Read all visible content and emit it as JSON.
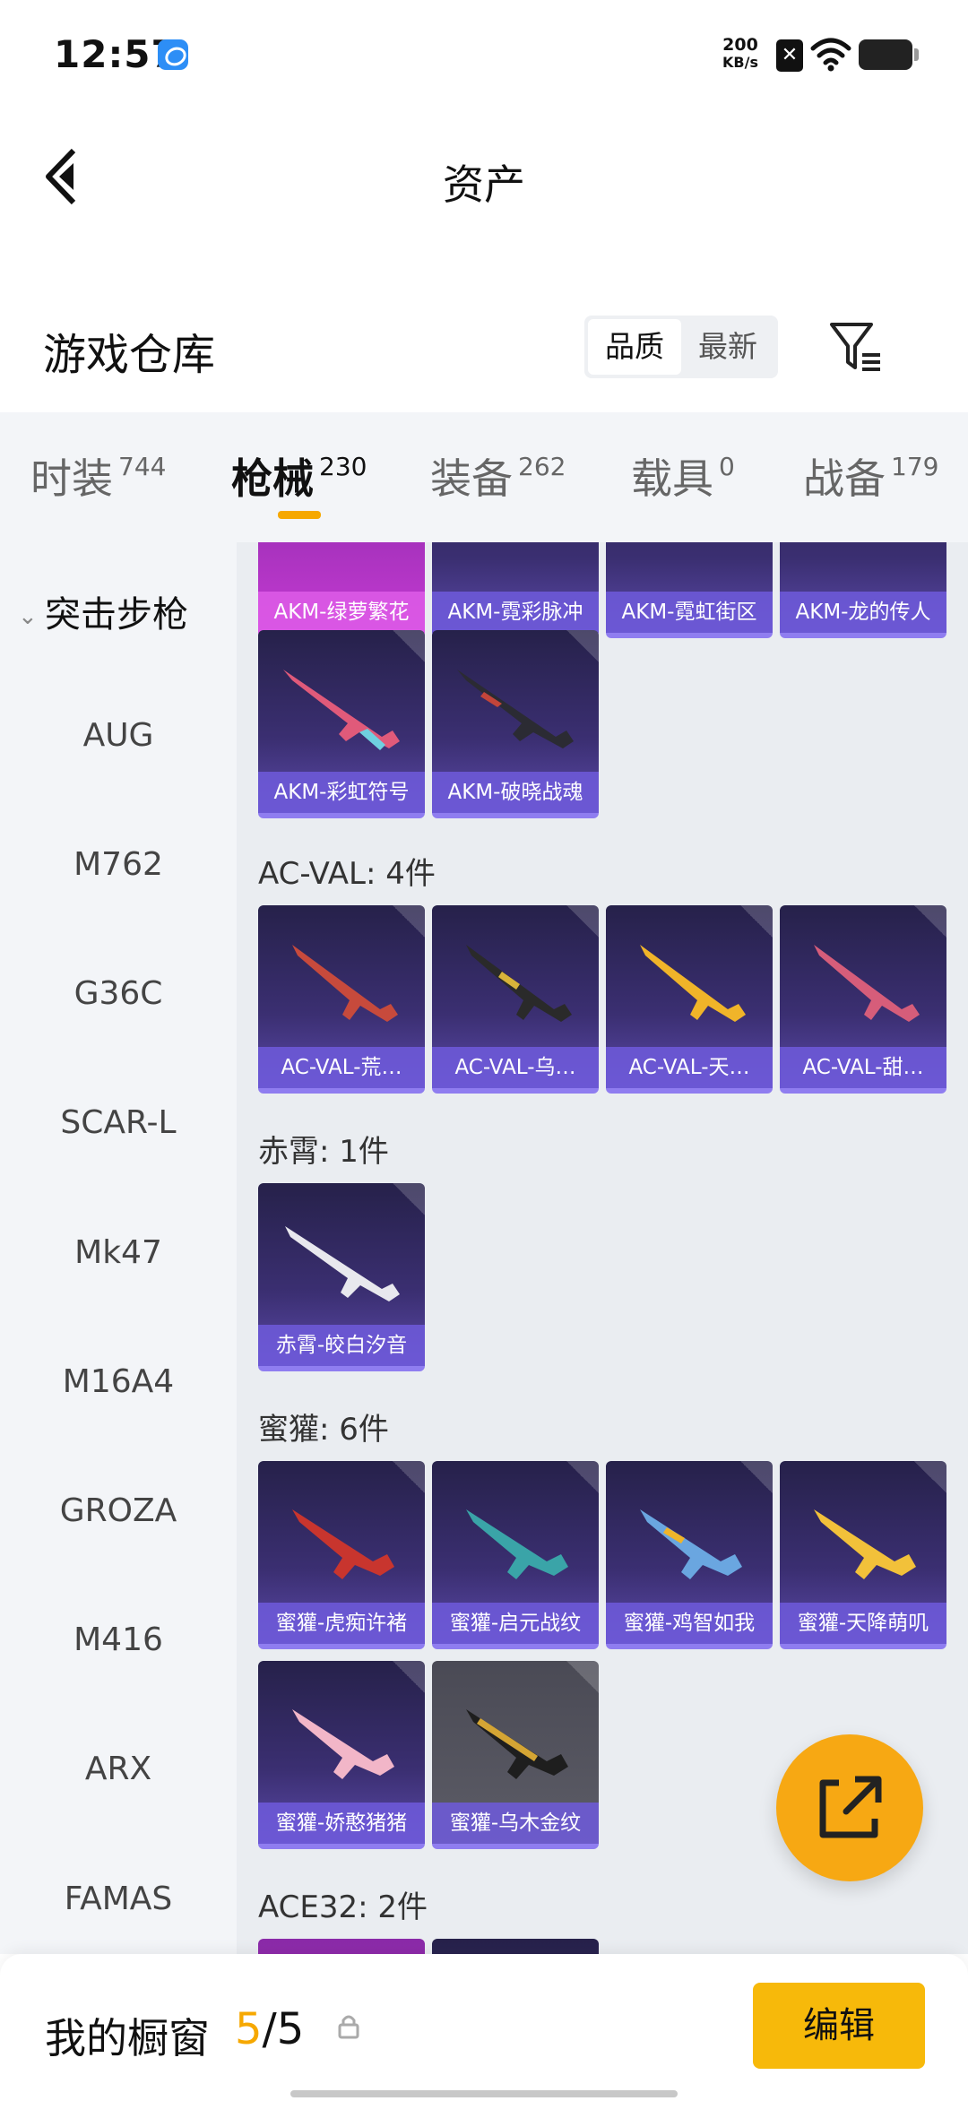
{
  "status_bar": {
    "time": "12:57",
    "net_speed_value": "200",
    "net_speed_unit": "KB/s"
  },
  "header": {
    "title": "资产"
  },
  "warehouse": {
    "title": "游戏仓库",
    "sort_options": [
      "品质",
      "最新"
    ],
    "active_sort": "品质"
  },
  "tabs": [
    {
      "label": "时装",
      "count": "744"
    },
    {
      "label": "枪械",
      "count": "230"
    },
    {
      "label": "装备",
      "count": "262"
    },
    {
      "label": "载具",
      "count": "0"
    },
    {
      "label": "战备",
      "count": "179"
    }
  ],
  "sidebar": {
    "category": "突击步枪",
    "items": [
      "AUG",
      "M762",
      "G36C",
      "SCAR-L",
      "Mk47",
      "M16A4",
      "GROZA",
      "M416",
      "ARX",
      "FAMAS"
    ]
  },
  "grid": {
    "akm_row1": [
      "AKM-绿萝繁花",
      "AKM-霓彩脉冲",
      "AKM-霓虹街区",
      "AKM-龙的传人"
    ],
    "akm_row2": [
      "AKM-彩虹符号",
      "AKM-破晓战魂"
    ],
    "acval_title": "AC-VAL: 4件",
    "acval": [
      "AC-VAL-荒…",
      "AC-VAL-乌…",
      "AC-VAL-天…",
      "AC-VAL-甜…"
    ],
    "chixiao_title": "赤霄: 1件",
    "chixiao": [
      "赤霄-皎白汐音"
    ],
    "mihuan_title": "蜜獾: 6件",
    "mihuan_row1": [
      "蜜獾-虎痴许褚",
      "蜜獾-启元战纹",
      "蜜獾-鸡智如我",
      "蜜獾-天降萌叽"
    ],
    "mihuan_row2": [
      "蜜獾-娇憨猪猪",
      "蜜獾-乌木金纹"
    ],
    "ace32_title": "ACE32: 2件"
  },
  "bottom": {
    "title": "我的橱窗",
    "count_current": "5",
    "count_sep_total": "/5",
    "edit_label": "编辑"
  },
  "colors": {
    "accent": "#f6a800",
    "card_purple": "#3b2f72",
    "edit_button": "#f7b90a"
  }
}
